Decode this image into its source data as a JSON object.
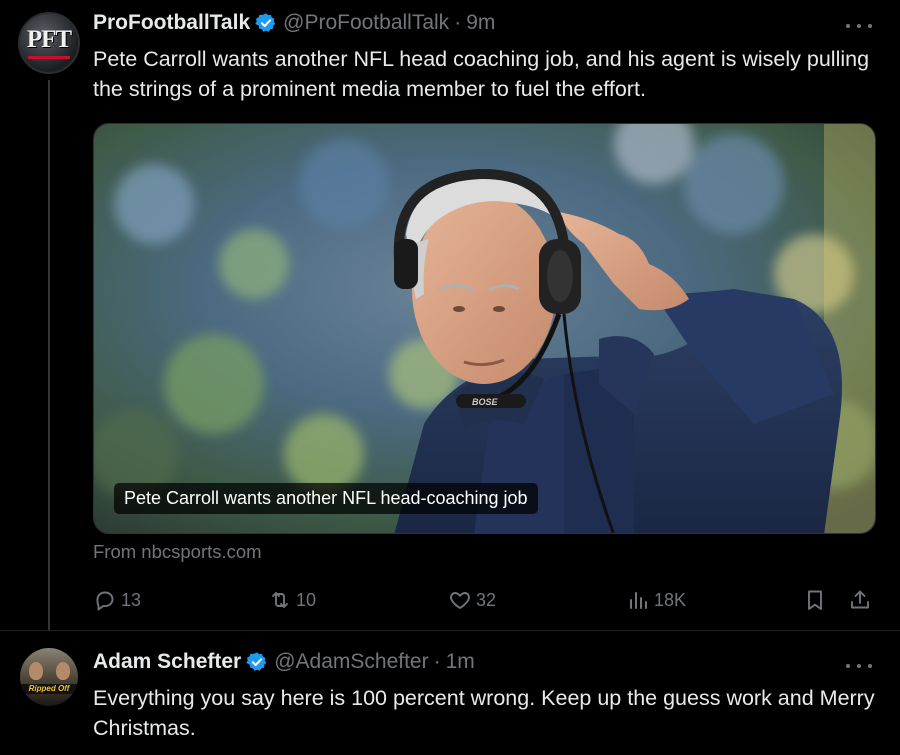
{
  "tweets": [
    {
      "display_name": "ProFootballTalk",
      "handle": "@ProFootballTalk",
      "separator": "·",
      "time": "9m",
      "avatar_text": "PFT",
      "text": "Pete Carroll wants another NFL head coaching job, and his agent is wisely pulling the strings of a prominent media member to fuel the effort.",
      "card": {
        "caption": "Pete Carroll wants another NFL head-coaching job",
        "headset_brand": "BOSE",
        "source": "From nbcsports.com"
      },
      "actions": {
        "replies": "13",
        "reposts": "10",
        "likes": "32",
        "views": "18K"
      }
    },
    {
      "display_name": "Adam Schefter",
      "handle": "@AdamSchefter",
      "separator": "·",
      "time": "1m",
      "avatar_text": "Ripped Off",
      "text": "Everything you say here is 100 percent wrong. Keep up the guess work and Merry Christmas."
    }
  ],
  "icons": {
    "verified": "verified-badge-icon",
    "more": "more-icon",
    "reply": "reply-icon",
    "repost": "repost-icon",
    "like": "like-icon",
    "views": "views-icon",
    "bookmark": "bookmark-icon",
    "share": "share-icon"
  },
  "colors": {
    "background": "#000000",
    "text_primary": "#e7e9ea",
    "text_secondary": "#71767b",
    "verified": "#1d9bf0",
    "border": "#2f3336"
  }
}
